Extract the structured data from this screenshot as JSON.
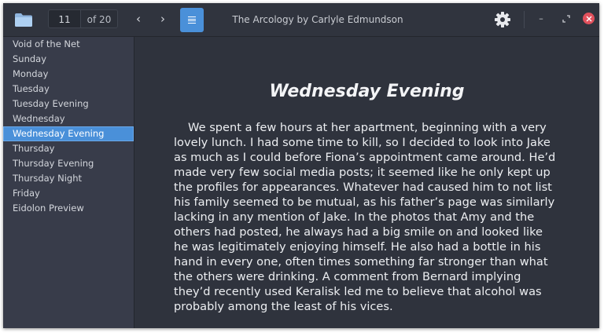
{
  "window": {
    "title": "The Arcology by Carlyle Edmundson"
  },
  "toolbar": {
    "current_page": "11",
    "page_total": "of 20",
    "prev_icon": "chevron-left-icon",
    "next_icon": "chevron-right-icon",
    "toc_icon": "table-of-contents-icon",
    "prev_glyph": "‹",
    "next_glyph": "›",
    "minimize_glyph": "–"
  },
  "colors": {
    "accent": "#4a90d9",
    "close": "#e0505c",
    "background": "#2f333d",
    "sidebar": "#383c4a"
  },
  "sidebar": {
    "items": [
      {
        "label": "Void of the Net"
      },
      {
        "label": "Sunday"
      },
      {
        "label": "Monday"
      },
      {
        "label": "Tuesday"
      },
      {
        "label": "Tuesday Evening"
      },
      {
        "label": "Wednesday"
      },
      {
        "label": "Wednesday Evening",
        "selected": true
      },
      {
        "label": "Thursday"
      },
      {
        "label": "Thursday Evening"
      },
      {
        "label": "Thursday Night"
      },
      {
        "label": "Friday"
      },
      {
        "label": "Eidolon Preview"
      }
    ]
  },
  "content": {
    "chapter_title": "Wednesday Evening",
    "paragraph": "We spent a few hours at her apartment, beginning with a very lovely lunch. I had some time to kill, so I decided to look into Jake as much as I could before Fiona’s appointment came around. He’d made very few social media posts; it seemed like he only kept up the profiles for appearances. Whatever had caused him to not list his family seemed to be mutual, as his father’s page was similarly lacking in any mention of Jake. In the photos that Amy and the others had posted, he always had a big smile on and looked like he was legitimately enjoying himself. He also had a bottle in his hand in every one, often times something far stronger than what the others were drinking. A comment from Bernard implying they’d recently used Keralisk led me to believe that alcohol was probably among the least of his vices."
  }
}
